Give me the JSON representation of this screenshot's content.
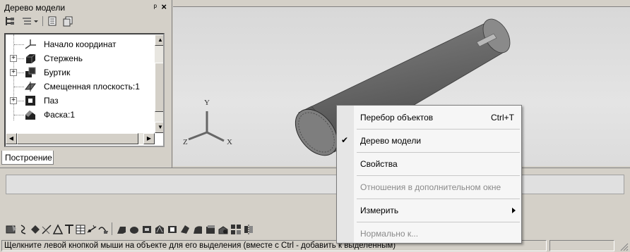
{
  "tree_panel": {
    "title": "Дерево модели",
    "pin_glyph": "ᵖ",
    "close_glyph": "×",
    "toolbar_icons": [
      "tree-view-icon",
      "filter-list-icon",
      "dropdown-arrow-icon",
      "document-icon",
      "copy-document-icon"
    ],
    "items": [
      {
        "label": "Начало координат",
        "icon": "axis-origin-icon",
        "expandable": false
      },
      {
        "label": "Стержень",
        "icon": "extrude-solid-icon",
        "expandable": true
      },
      {
        "label": "Буртик",
        "icon": "boss-solid-icon",
        "expandable": true
      },
      {
        "label": "Смещенная плоскость:1",
        "icon": "offset-plane-icon",
        "expandable": false
      },
      {
        "label": "Паз",
        "icon": "slot-cut-icon",
        "expandable": true
      },
      {
        "label": "Фаска:1",
        "icon": "chamfer-icon",
        "expandable": false
      }
    ],
    "tab_label": "Построение"
  },
  "viewport": {
    "axis_labels": {
      "x": "X",
      "y": "Y",
      "z": "Z"
    }
  },
  "context_menu": {
    "items": [
      {
        "label": "Перебор объектов",
        "shortcut": "Ctrl+T",
        "enabled": true,
        "checked": false,
        "submenu": false
      },
      {
        "label": "Дерево модели",
        "shortcut": "",
        "enabled": true,
        "checked": true,
        "submenu": false
      },
      {
        "label": "Свойства",
        "shortcut": "",
        "enabled": true,
        "checked": false,
        "submenu": false
      },
      {
        "label": "Отношения в дополнительном окне",
        "shortcut": "",
        "enabled": false,
        "checked": false,
        "submenu": false
      },
      {
        "label": "Измерить",
        "shortcut": "",
        "enabled": true,
        "checked": false,
        "submenu": true
      },
      {
        "label": "Нормально к...",
        "shortcut": "",
        "enabled": false,
        "checked": false,
        "submenu": false
      }
    ],
    "check_glyph": "✔"
  },
  "bottom_toolbar": {
    "icons": [
      "sketch-icon",
      "spline-icon",
      "point-icon",
      "auxiliary-line-icon",
      "triangle-icon",
      "text-icon",
      "table-icon",
      "dimension-icon",
      "edit-icon",
      "extrude-icon",
      "rotate-icon",
      "kinematic-icon",
      "loft-icon",
      "cut-extrude-icon",
      "cut-rotate-icon",
      "fillet-icon",
      "shell-icon",
      "rib-icon",
      "pattern-icon",
      "mirror-icon"
    ]
  },
  "status_bar": {
    "text": "Щелкните левой кнопкой мыши на объекте для его выделения (вместе с Ctrl - добавить к выделенным)"
  },
  "colors": {
    "window_bg": "#d4d0c8",
    "viewport_bg": "#dcdcdc",
    "menu_bg": "#f6f6f6",
    "part_body": "#6a6a6a"
  }
}
